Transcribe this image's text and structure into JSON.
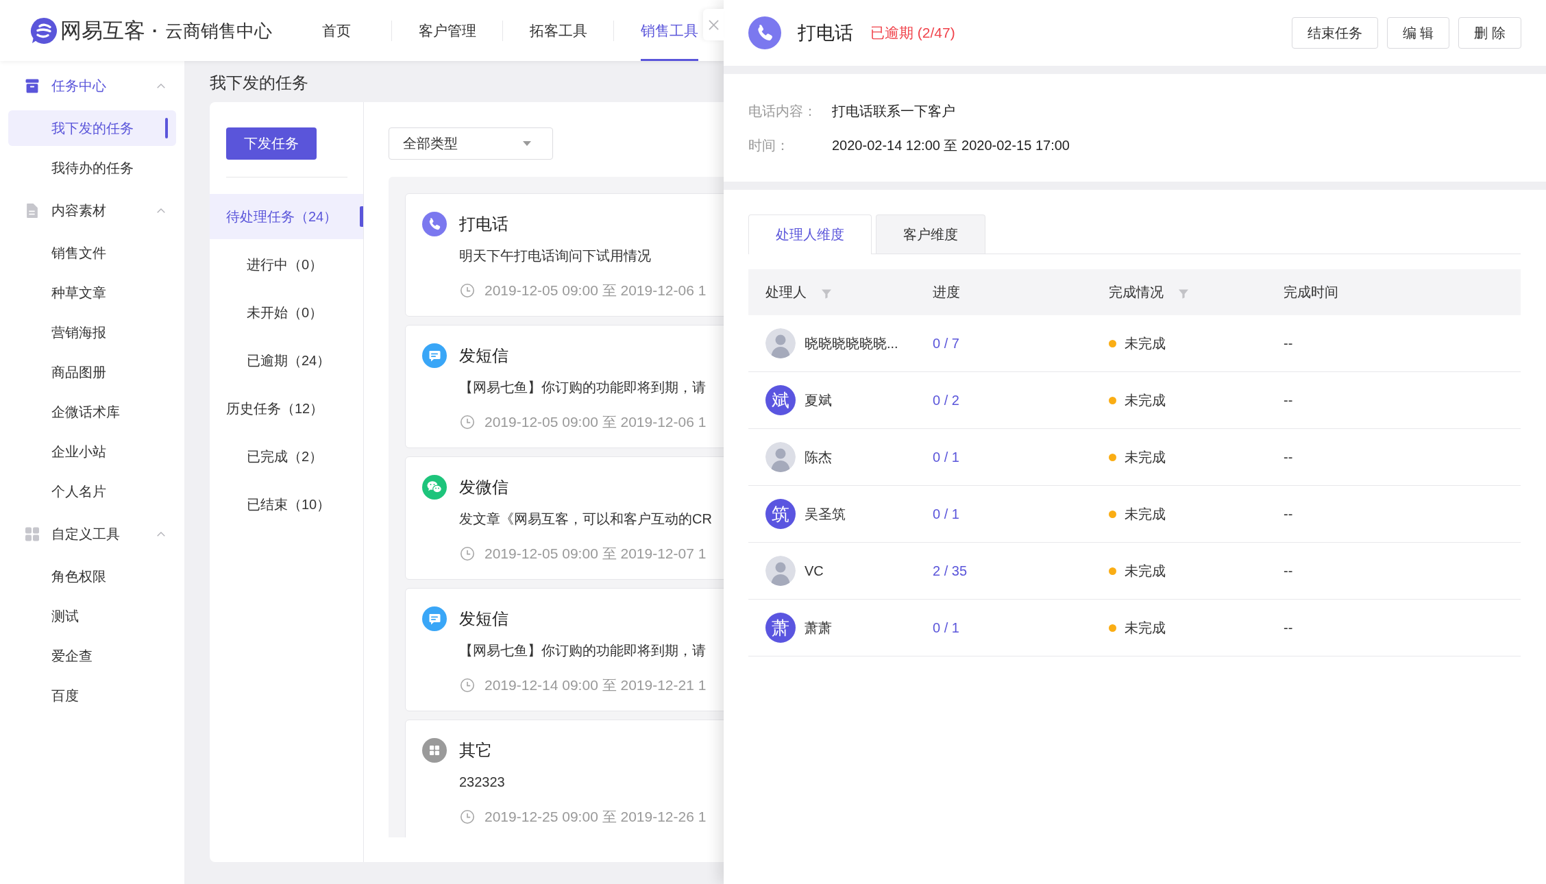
{
  "header": {
    "logo": {
      "brand": "网易互客",
      "separator": "·",
      "product": "云商销售中心"
    },
    "nav": [
      {
        "label": "首页",
        "selected": false
      },
      {
        "label": "客户管理",
        "selected": false
      },
      {
        "label": "拓客工具",
        "selected": false
      },
      {
        "label": "销售工具",
        "selected": true
      }
    ]
  },
  "sidebar": {
    "groups": [
      {
        "kind": "tasks",
        "label": "任务中心",
        "expanded": true,
        "items": [
          {
            "label": "我下发的任务",
            "selected": true
          },
          {
            "label": "我待办的任务",
            "selected": false
          }
        ]
      },
      {
        "kind": "content",
        "label": "内容素材",
        "expanded": true,
        "items": [
          {
            "label": "销售文件",
            "selected": false
          },
          {
            "label": "种草文章",
            "selected": false
          },
          {
            "label": "营销海报",
            "selected": false
          },
          {
            "label": "商品图册",
            "selected": false
          },
          {
            "label": "企微话术库",
            "selected": false
          },
          {
            "label": "企业小站",
            "selected": false
          },
          {
            "label": "个人名片",
            "selected": false
          }
        ]
      },
      {
        "kind": "tools",
        "label": "自定义工具",
        "expanded": true,
        "items": [
          {
            "label": "角色权限",
            "selected": false
          },
          {
            "label": "测试",
            "selected": false
          },
          {
            "label": "爱企查",
            "selected": false
          },
          {
            "label": "百度",
            "selected": false
          }
        ]
      }
    ]
  },
  "page": {
    "title": "我下发的任务",
    "create_button": "下发任务",
    "filters": [
      {
        "label": "待处理任务（24）",
        "selected": true,
        "children": [
          {
            "label": "进行中（0）",
            "selected": false
          },
          {
            "label": "未开始（0）",
            "selected": false
          },
          {
            "label": "已逾期（24）",
            "selected": false
          }
        ]
      },
      {
        "label": "历史任务（12）",
        "selected": false,
        "children": [
          {
            "label": "已完成（2）",
            "selected": false
          },
          {
            "label": "已结束（10）",
            "selected": false
          }
        ]
      }
    ],
    "type_select": {
      "value": "全部类型"
    },
    "tasks": [
      {
        "kind": "call",
        "title": "打电话",
        "description": "明天下午打电话询问下试用情况",
        "time": "2019-12-05 09:00 至 2019-12-06 1"
      },
      {
        "kind": "sms",
        "title": "发短信",
        "description": "【网易七鱼】你订购的功能即将到期，请",
        "time": "2019-12-05 09:00 至 2019-12-06 1"
      },
      {
        "kind": "wechat",
        "title": "发微信",
        "description": "发文章《网易互客，可以和客户互动的CR",
        "time": "2019-12-05 09:00 至 2019-12-07 1"
      },
      {
        "kind": "sms",
        "title": "发短信",
        "description": "【网易七鱼】你订购的功能即将到期，请",
        "time": "2019-12-14 09:00 至 2019-12-21 1"
      },
      {
        "kind": "other",
        "title": "其它",
        "description": "232323",
        "time": "2019-12-25 09:00 至 2019-12-26 1"
      }
    ]
  },
  "drawer": {
    "task": {
      "kind": "call",
      "title": "打电话",
      "status": "已逾期 (2/47)"
    },
    "actions": [
      "结束任务",
      "编 辑",
      "删 除"
    ],
    "details": [
      {
        "label": "电话内容：",
        "value": "打电话联系一下客户"
      },
      {
        "label": "时间：",
        "value": "2020-02-14 12:00 至 2020-02-15 17:00"
      }
    ],
    "tabs": [
      {
        "label": "处理人维度",
        "selected": true
      },
      {
        "label": "客户维度",
        "selected": false
      }
    ],
    "table": {
      "columns": [
        {
          "label": "处理人",
          "filter": true
        },
        {
          "label": "进度",
          "filter": false
        },
        {
          "label": "完成情况",
          "filter": true
        },
        {
          "label": "完成时间",
          "filter": false
        }
      ],
      "rows": [
        {
          "avatar": {
            "kind": "photo"
          },
          "name": "晓晓晓晓晓晓...",
          "progress": "0 / 7",
          "status": "未完成",
          "color": "#faad14",
          "finished_at": "--"
        },
        {
          "avatar": {
            "kind": "letter",
            "text": "斌"
          },
          "name": "夏斌",
          "progress": "0 / 2",
          "status": "未完成",
          "color": "#faad14",
          "finished_at": "--"
        },
        {
          "avatar": {
            "kind": "photo"
          },
          "name": "陈杰",
          "progress": "0 / 1",
          "status": "未完成",
          "color": "#faad14",
          "finished_at": "--"
        },
        {
          "avatar": {
            "kind": "letter",
            "text": "筑"
          },
          "name": "吴圣筑",
          "progress": "0 / 1",
          "status": "未完成",
          "color": "#faad14",
          "finished_at": "--"
        },
        {
          "avatar": {
            "kind": "photo"
          },
          "name": "VC",
          "progress": "2 / 35",
          "status": "未完成",
          "color": "#faad14",
          "finished_at": "--"
        },
        {
          "avatar": {
            "kind": "letter",
            "text": "萧"
          },
          "name": "萧萧",
          "progress": "0 / 1",
          "status": "未完成",
          "color": "#faad14",
          "finished_at": "--"
        }
      ]
    }
  }
}
